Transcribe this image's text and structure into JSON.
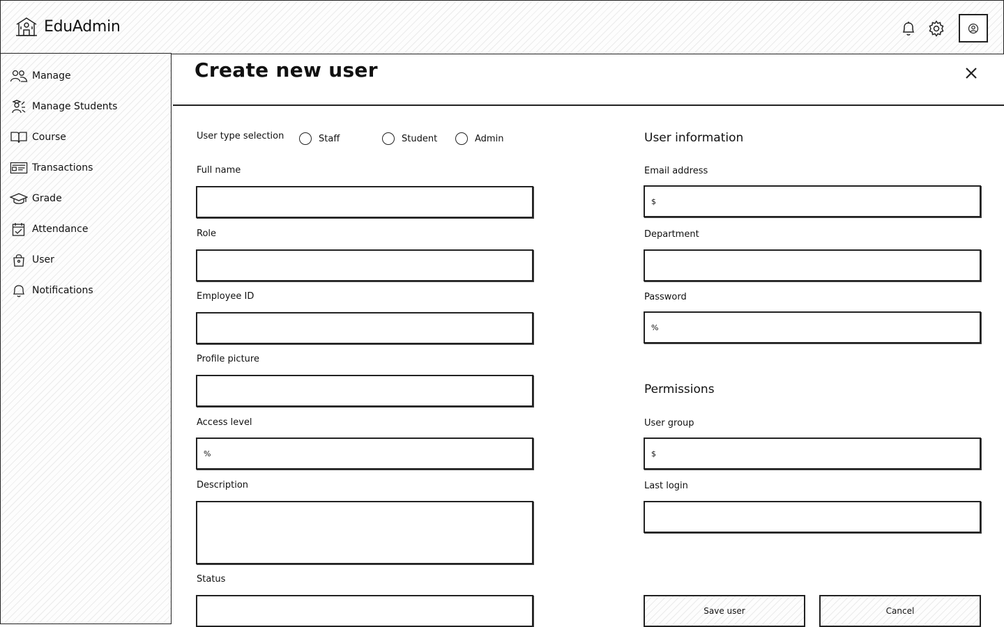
{
  "app": {
    "title": "EduAdmin"
  },
  "header": {
    "icons": [
      "bell-icon",
      "gear-icon",
      "user-circle-icon"
    ]
  },
  "sidebar": {
    "items": [
      {
        "label": "Manage",
        "icon": "users-icon"
      },
      {
        "label": "Manage Students",
        "icon": "student-icon"
      },
      {
        "label": "Course",
        "icon": "book-icon"
      },
      {
        "label": "Transactions",
        "icon": "card-icon"
      },
      {
        "label": "Grade",
        "icon": "graduation-cap-icon"
      },
      {
        "label": "Attendance",
        "icon": "calendar-check-icon"
      },
      {
        "label": "User",
        "icon": "bag-icon"
      },
      {
        "label": "Notifications",
        "icon": "bell-icon"
      }
    ]
  },
  "page": {
    "title": "Create new user"
  },
  "form": {
    "user_type_label": "User type selection",
    "user_types": [
      "Staff",
      "Student",
      "Admin"
    ],
    "left": {
      "full_name": {
        "label": "Full name",
        "value": ""
      },
      "role": {
        "label": "Role",
        "value": ""
      },
      "employee_id": {
        "label": "Employee ID",
        "value": ""
      },
      "profile_picture": {
        "label": "Profile picture",
        "value": ""
      },
      "access_level": {
        "label": "Access level",
        "value": "%"
      },
      "description": {
        "label": "Description",
        "value": ""
      },
      "status": {
        "label": "Status",
        "value": ""
      }
    },
    "user_info": {
      "heading": "User information",
      "email": {
        "label": "Email address",
        "value": "$"
      },
      "department": {
        "label": "Department",
        "value": ""
      },
      "password": {
        "label": "Password",
        "value": "%"
      }
    },
    "permissions": {
      "heading": "Permissions",
      "user_group": {
        "label": "User group",
        "value": "$"
      },
      "last_login": {
        "label": "Last login",
        "value": ""
      }
    },
    "buttons": {
      "save": "Save user",
      "cancel": "Cancel"
    }
  }
}
